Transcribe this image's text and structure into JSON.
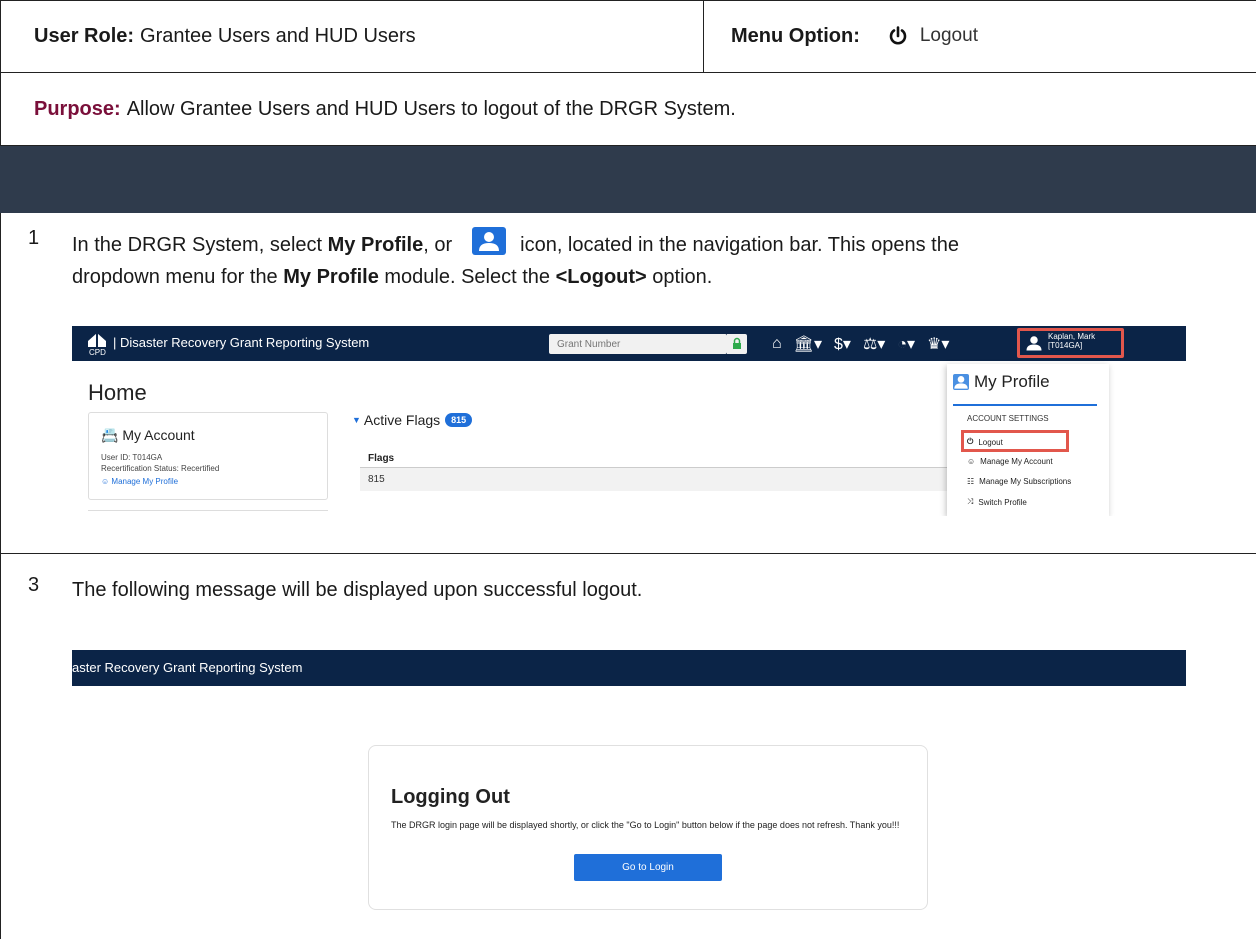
{
  "header": {
    "user_role_label": "User Role:",
    "user_role_value": "Grantee Users and HUD Users",
    "menu_option_label": "Menu Option:",
    "menu_option_value": "Logout",
    "menu_option_icon": "power-icon"
  },
  "purpose": {
    "label": "Purpose:",
    "text": "Allow Grantee Users and HUD Users to logout of the DRGR System."
  },
  "step1": {
    "number": "1",
    "text_a": "In the DRGR System, select ",
    "bold_a": "My Profile",
    "text_b": ", or",
    "text_c": "icon, located in the navigation bar. This opens the",
    "text_d": "dropdown menu for the ",
    "bold_b": "My Profile",
    "text_e": " module. Select the ",
    "bold_c": "<Logout>",
    "text_f": " option.",
    "screenshot": {
      "logo_text": "CPD",
      "app_title": "Disaster Recovery Grant Reporting System",
      "grant_placeholder": "Grant Number",
      "user_name_line1": "Kaplan, Mark",
      "user_name_line2": "[T014GA]",
      "nav_icons": [
        "home-icon",
        "bank-icon",
        "dollar-icon",
        "scales-icon",
        "pie-chart-icon",
        "crown-icon",
        "user-icon"
      ],
      "home_title": "Home",
      "account_title": "My Account",
      "user_id": "User ID: T014GA",
      "recert_status": "Recertification Status: Recertified",
      "manage_profile_link": "Manage My Profile",
      "active_flags_label": "Active Flags",
      "active_flags_count": "815",
      "flags_column": "Flags",
      "flags_value": "815",
      "dropdown": {
        "title": "My Profile",
        "section": "ACCOUNT SETTINGS",
        "items": [
          "Logout",
          "Manage My Account",
          "Manage My Subscriptions",
          "Switch Profile"
        ]
      }
    }
  },
  "step3": {
    "number": "3",
    "text": "The following message will be displayed upon successful logout.",
    "screenshot": {
      "app_title": "aster Recovery Grant Reporting System",
      "card_title": "Logging Out",
      "card_message": "The DRGR login page will be displayed shortly, or click the \"Go to Login\" button below if the page does not refresh. Thank you!!!",
      "button_label": "Go to Login"
    }
  },
  "colors": {
    "nav_bg": "#0b2447",
    "band_bg": "#2f3b4c",
    "accent_blue": "#1f6fd9",
    "highlight_red": "#e2574c"
  }
}
